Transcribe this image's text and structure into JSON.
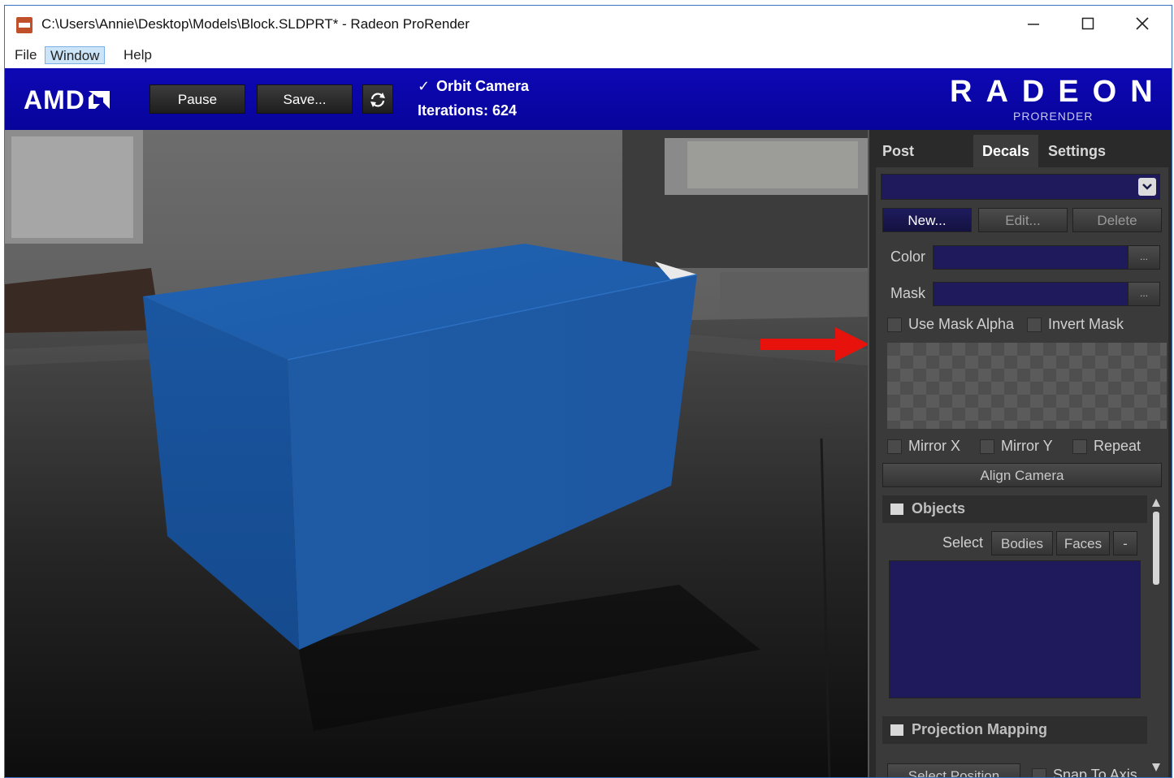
{
  "window": {
    "title": "C:\\Users\\Annie\\Desktop\\Models\\Block.SLDPRT* - Radeon ProRender"
  },
  "menu": {
    "items": [
      {
        "label": "File"
      },
      {
        "label": "Window"
      },
      {
        "label": "Help"
      }
    ]
  },
  "toolbar": {
    "brand": "AMD",
    "pause_label": "Pause",
    "save_label": "Save...",
    "orbit_label": "Orbit Camera",
    "orbit_checked": true,
    "iterations_label": "Iterations: 624",
    "radeon_wordmark": "RADEON",
    "radeon_sub": "PRORENDER"
  },
  "panel": {
    "tabs": [
      {
        "label": "Post Effects"
      },
      {
        "label": "Decals",
        "active": true
      },
      {
        "label": "Settings"
      }
    ],
    "decals": {
      "new_label": "New...",
      "edit_label": "Edit...",
      "delete_label": "Delete",
      "color_label": "Color",
      "mask_label": "Mask",
      "browse_label": "...",
      "use_mask_alpha": "Use Mask Alpha",
      "invert_mask": "Invert Mask",
      "mirror_x": "Mirror X",
      "mirror_y": "Mirror Y",
      "repeat": "Repeat",
      "align_camera": "Align Camera"
    },
    "objects": {
      "title": "Objects",
      "select_label": "Select",
      "bodies_label": "Bodies",
      "faces_label": "Faces",
      "minus_label": "-"
    },
    "projection": {
      "title": "Projection Mapping",
      "select_position": "Select Position",
      "snap_to_axis": "Snap To Axis"
    }
  },
  "colors": {
    "toolbar_blue": "#0b07a8",
    "field_navy": "#1e1a5c",
    "box_blue": "#1d5aa8",
    "arrow_red": "#e8120c"
  }
}
